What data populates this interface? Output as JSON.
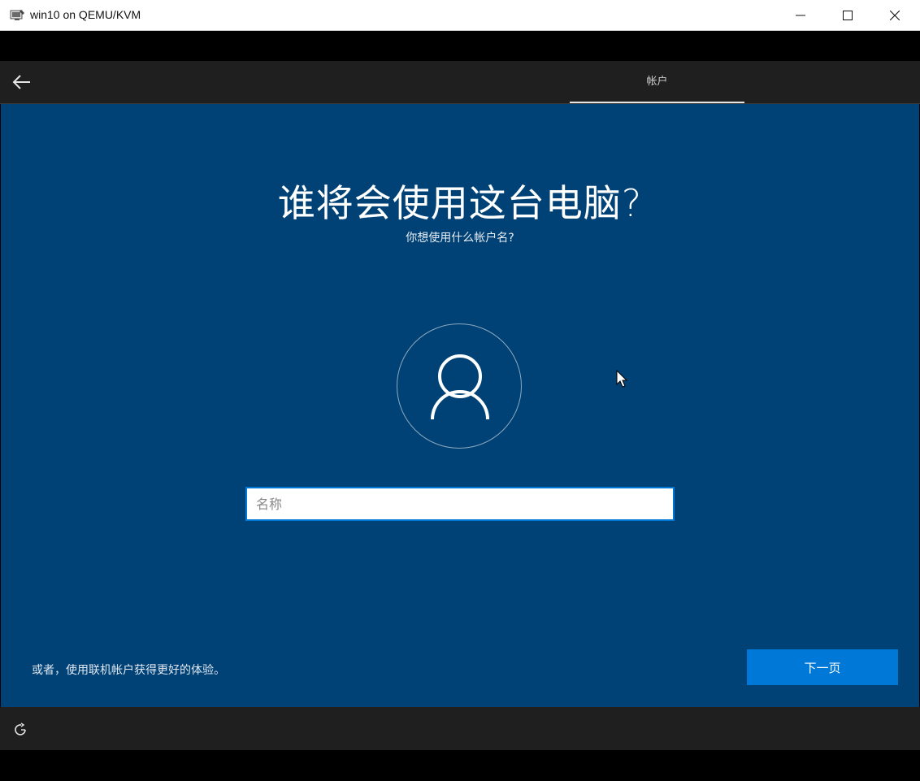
{
  "window": {
    "title": "win10 on QEMU/KVM",
    "icons": {
      "app": "vm-monitor-icon",
      "minimize": "minimize-icon",
      "maximize": "maximize-icon",
      "close": "close-icon"
    }
  },
  "header": {
    "back_icon": "back-arrow-icon",
    "active_tab": "帐户"
  },
  "main": {
    "heading": "谁将会使用这台电脑?",
    "subheading": "你想使用什么帐户名?",
    "avatar_icon": "user-icon",
    "name_input": {
      "placeholder": "名称",
      "value": ""
    },
    "online_account_link": "或者，使用联机帐户获得更好的体验。",
    "next_button": "下一页"
  },
  "footer": {
    "accessibility_icon": "ease-of-access-icon"
  },
  "colors": {
    "background": "#004275",
    "header_bar": "#1f1f1f",
    "accent": "#0078d7",
    "text": "#ffffff"
  }
}
